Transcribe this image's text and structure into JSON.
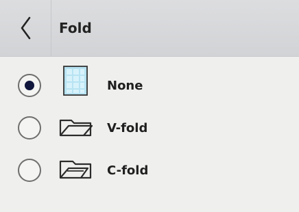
{
  "header": {
    "title": "Fold"
  },
  "fold_options": {
    "selected": "None",
    "items": [
      {
        "label": "None",
        "icon": "flat-sheet-icon",
        "selected": true
      },
      {
        "label": "V-fold",
        "icon": "v-fold-icon",
        "selected": false
      },
      {
        "label": "C-fold",
        "icon": "c-fold-icon",
        "selected": false
      }
    ]
  },
  "colors": {
    "header_background": "#d6d7da",
    "page_background": "#efefed",
    "selected_radio": "#10163c",
    "sheet_fill": "#b7e3f2"
  }
}
